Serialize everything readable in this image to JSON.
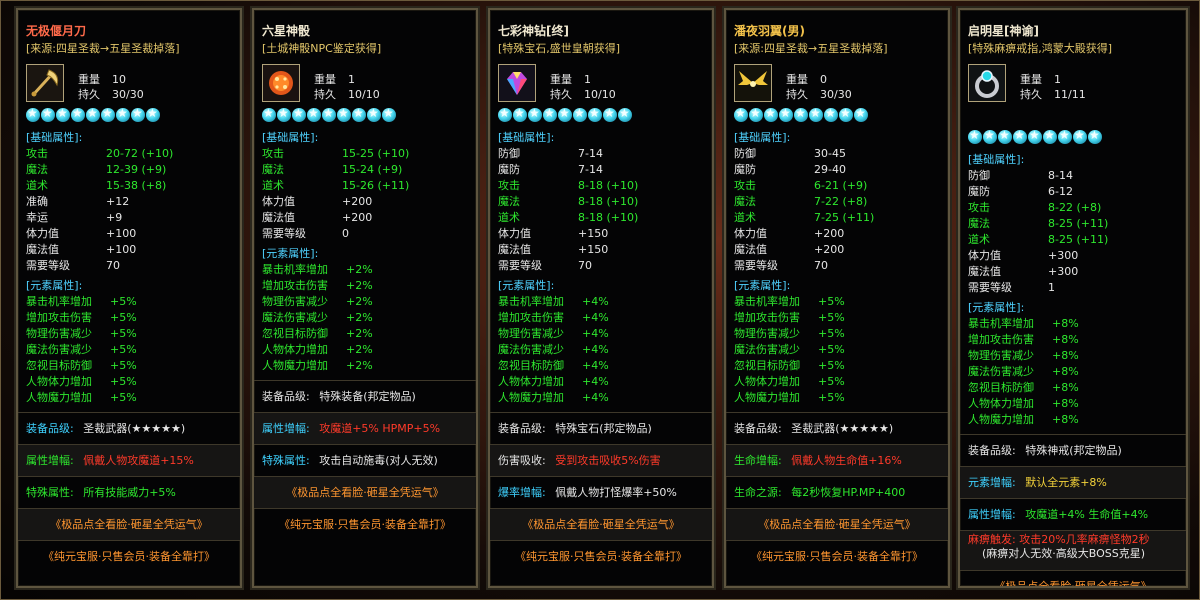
{
  "cards": [
    {
      "title": "无极偃月刀",
      "source": "[来源:四星圣裁→五星圣裁掉落]",
      "icon": "crescent-blade-icon",
      "weight_label": "重量",
      "weight": "10",
      "durability_label": "持久",
      "durability": "30/30",
      "star_count": 9,
      "base_head": "[基础属性]:",
      "base": [
        {
          "k": "攻击",
          "v": "20-72 (+10)",
          "c": "green"
        },
        {
          "k": "魔法",
          "v": "12-39 (+9)",
          "c": "green"
        },
        {
          "k": "道术",
          "v": "15-38 (+8)",
          "c": "green"
        },
        {
          "k": "准确",
          "v": "+12",
          "c": "white"
        },
        {
          "k": "幸运",
          "v": "+9",
          "c": "white"
        },
        {
          "k": "体力值",
          "v": "+100",
          "c": "white"
        },
        {
          "k": "魔法值",
          "v": "+100",
          "c": "white"
        },
        {
          "k": "需要等级",
          "v": "70",
          "c": "white"
        }
      ],
      "elem_head": "[元素属性]:",
      "elem": [
        {
          "k": "暴击机率增加",
          "v": "+5%"
        },
        {
          "k": "增加攻击伤害",
          "v": "+5%"
        },
        {
          "k": "物理伤害减少",
          "v": "+5%"
        },
        {
          "k": "魔法伤害减少",
          "v": "+5%"
        },
        {
          "k": "忽视目标防御",
          "v": "+5%"
        },
        {
          "k": "人物体力增加",
          "v": "+5%"
        },
        {
          "k": "人物魔力增加",
          "v": "+5%"
        }
      ],
      "bands": [
        {
          "k": "装备品级:",
          "v": "圣裁武器(★★★★★)",
          "kc": "cyan",
          "vc": "white"
        },
        {
          "k": "属性增幅:",
          "v": "佩戴人物攻魔道+15%",
          "kc": "green",
          "vc": "red"
        },
        {
          "k": "特殊属性:",
          "v": "所有技能威力+5%",
          "kc": "green",
          "vc": "green"
        },
        {
          "center": "《极品点全看脸·砸星全凭运气》"
        },
        {
          "center": "《纯元宝服·只售会员·装备全靠打》"
        }
      ]
    },
    {
      "title": "六星神骰",
      "source": "[土城神骰NPC鉴定获得]",
      "icon": "dice-icon",
      "weight_label": "重量",
      "weight": "1",
      "durability_label": "持久",
      "durability": "10/10",
      "star_count": 9,
      "base_head": "[基础属性]:",
      "base": [
        {
          "k": "攻击",
          "v": "15-25 (+10)",
          "c": "green"
        },
        {
          "k": "魔法",
          "v": "15-24 (+9)",
          "c": "green"
        },
        {
          "k": "道术",
          "v": "15-26 (+11)",
          "c": "green"
        },
        {
          "k": "体力值",
          "v": "+200",
          "c": "white"
        },
        {
          "k": "魔法值",
          "v": "+200",
          "c": "white"
        },
        {
          "k": "需要等级",
          "v": "0",
          "c": "white"
        }
      ],
      "elem_head": "[元素属性]:",
      "elem": [
        {
          "k": "暴击机率增加",
          "v": "+2%"
        },
        {
          "k": "增加攻击伤害",
          "v": "+2%"
        },
        {
          "k": "物理伤害减少",
          "v": "+2%"
        },
        {
          "k": "魔法伤害减少",
          "v": "+2%"
        },
        {
          "k": "忽视目标防御",
          "v": "+2%"
        },
        {
          "k": "人物体力增加",
          "v": "+2%"
        },
        {
          "k": "人物魔力增加",
          "v": "+2%"
        }
      ],
      "bands": [
        {
          "k": "装备品级:",
          "v": "特殊装备(邦定物品)",
          "kc": "white",
          "vc": "white"
        },
        {
          "k": "属性增幅:",
          "v": "攻魔道+5% HPMP+5%",
          "kc": "cyan",
          "vc": "red"
        },
        {
          "k": "特殊属性:",
          "v": "攻击自动施毒(对人无效)",
          "kc": "cyan",
          "vc": "white"
        },
        {
          "center": "《极品点全看脸·砸星全凭运气》"
        },
        {
          "center": "《纯元宝服·只售会员·装备全靠打》"
        }
      ]
    },
    {
      "title": "七彩神钻[终]",
      "source": "[特殊宝石,盛世皇朝获得]",
      "icon": "diamond-icon",
      "weight_label": "重量",
      "weight": "1",
      "durability_label": "持久",
      "durability": "10/10",
      "star_count": 9,
      "base_head": "[基础属性]:",
      "base": [
        {
          "k": "防御",
          "v": "7-14",
          "c": "white"
        },
        {
          "k": "魔防",
          "v": "7-14",
          "c": "white"
        },
        {
          "k": "攻击",
          "v": "8-18 (+10)",
          "c": "green"
        },
        {
          "k": "魔法",
          "v": "8-18 (+10)",
          "c": "green"
        },
        {
          "k": "道术",
          "v": "8-18 (+10)",
          "c": "green"
        },
        {
          "k": "体力值",
          "v": "+150",
          "c": "white"
        },
        {
          "k": "魔法值",
          "v": "+150",
          "c": "white"
        },
        {
          "k": "需要等级",
          "v": "70",
          "c": "white"
        }
      ],
      "elem_head": "[元素属性]:",
      "elem": [
        {
          "k": "暴击机率增加",
          "v": "+4%"
        },
        {
          "k": "增加攻击伤害",
          "v": "+4%"
        },
        {
          "k": "物理伤害减少",
          "v": "+4%"
        },
        {
          "k": "魔法伤害减少",
          "v": "+4%"
        },
        {
          "k": "忽视目标防御",
          "v": "+4%"
        },
        {
          "k": "人物体力增加",
          "v": "+4%"
        },
        {
          "k": "人物魔力增加",
          "v": "+4%"
        }
      ],
      "bands": [
        {
          "k": "装备品级:",
          "v": "特殊宝石(邦定物品)",
          "kc": "white",
          "vc": "white"
        },
        {
          "k": "伤害吸收:",
          "v": "受到攻击吸收5%伤害",
          "kc": "white",
          "vc": "red"
        },
        {
          "k": "爆率增幅:",
          "v": "佩戴人物打怪爆率+50%",
          "kc": "cyan",
          "vc": "white"
        },
        {
          "center": "《极品点全看脸·砸星全凭运气》"
        },
        {
          "center": "《纯元宝服·只售会员·装备全靠打》"
        }
      ]
    },
    {
      "title": "潘夜羽翼(男)",
      "source": "[来源:四星圣裁→五星圣裁掉落]",
      "icon": "wings-icon",
      "weight_label": "重量",
      "weight": "0",
      "durability_label": "持久",
      "durability": "30/30",
      "star_count": 9,
      "base_head": "[基础属性]:",
      "base": [
        {
          "k": "防御",
          "v": "30-45",
          "c": "white"
        },
        {
          "k": "魔防",
          "v": "29-40",
          "c": "white"
        },
        {
          "k": "攻击",
          "v": "6-21 (+9)",
          "c": "green"
        },
        {
          "k": "魔法",
          "v": "7-22 (+8)",
          "c": "green"
        },
        {
          "k": "道术",
          "v": "7-25 (+11)",
          "c": "green"
        },
        {
          "k": "体力值",
          "v": "+200",
          "c": "white"
        },
        {
          "k": "魔法值",
          "v": "+200",
          "c": "white"
        },
        {
          "k": "需要等级",
          "v": "70",
          "c": "white"
        }
      ],
      "elem_head": "[元素属性]:",
      "elem": [
        {
          "k": "暴击机率增加",
          "v": "+5%"
        },
        {
          "k": "增加攻击伤害",
          "v": "+5%"
        },
        {
          "k": "物理伤害减少",
          "v": "+5%"
        },
        {
          "k": "魔法伤害减少",
          "v": "+5%"
        },
        {
          "k": "忽视目标防御",
          "v": "+5%"
        },
        {
          "k": "人物体力增加",
          "v": "+5%"
        },
        {
          "k": "人物魔力增加",
          "v": "+5%"
        }
      ],
      "bands": [
        {
          "k": "装备品级:",
          "v": "圣裁武器(★★★★★)",
          "kc": "white",
          "vc": "white"
        },
        {
          "k": "生命增幅:",
          "v": "佩戴人物生命值+16%",
          "kc": "green",
          "vc": "red"
        },
        {
          "k": "生命之源:",
          "v": "每2秒恢复HP.MP+400",
          "kc": "green",
          "vc": "green"
        },
        {
          "center": "《极品点全看脸·砸星全凭运气》"
        },
        {
          "center": "《纯元宝服·只售会员·装备全靠打》"
        }
      ]
    },
    {
      "title": "启明星[神谕]",
      "source": "[特殊麻痹戒指,鸿蒙大殿获得]",
      "icon": "ring-icon",
      "weight_label": "重量",
      "weight": "1",
      "durability_label": "持久",
      "durability": "11/11",
      "star_count": 9,
      "base_head": "[基础属性]:",
      "base": [
        {
          "k": "防御",
          "v": "8-14",
          "c": "white"
        },
        {
          "k": "魔防",
          "v": "6-12",
          "c": "white"
        },
        {
          "k": "攻击",
          "v": "8-22 (+8)",
          "c": "green"
        },
        {
          "k": "魔法",
          "v": "8-25 (+11)",
          "c": "green"
        },
        {
          "k": "道术",
          "v": "8-25 (+11)",
          "c": "green"
        },
        {
          "k": "体力值",
          "v": "+300",
          "c": "white"
        },
        {
          "k": "魔法值",
          "v": "+300",
          "c": "white"
        },
        {
          "k": "需要等级",
          "v": "1",
          "c": "white"
        }
      ],
      "elem_head": "[元素属性]:",
      "elem": [
        {
          "k": "暴击机率增加",
          "v": "+8%"
        },
        {
          "k": "增加攻击伤害",
          "v": "+8%"
        },
        {
          "k": "物理伤害减少",
          "v": "+8%"
        },
        {
          "k": "魔法伤害减少",
          "v": "+8%"
        },
        {
          "k": "忽视目标防御",
          "v": "+8%"
        },
        {
          "k": "人物体力增加",
          "v": "+8%"
        },
        {
          "k": "人物魔力增加",
          "v": "+8%"
        }
      ],
      "bands": [
        {
          "k": "装备品级:",
          "v": "特殊神戒(邦定物品)",
          "kc": "white",
          "vc": "white"
        },
        {
          "k": "元素增幅:",
          "v": "默认全元素+8%",
          "kc": "cyan",
          "vc": "yellow"
        },
        {
          "k": "属性增幅:",
          "v": "攻魔道+4% 生命值+4%",
          "kc": "cyan",
          "vc": "green"
        },
        {
          "two": true,
          "l1": "麻痹触发: 攻击20%几率麻痹怪物2秒",
          "l2": "(麻痹对人无效·高级大BOSS克星)"
        },
        {
          "center": "《极品点全看脸·砸星全凭运气》"
        }
      ]
    }
  ]
}
